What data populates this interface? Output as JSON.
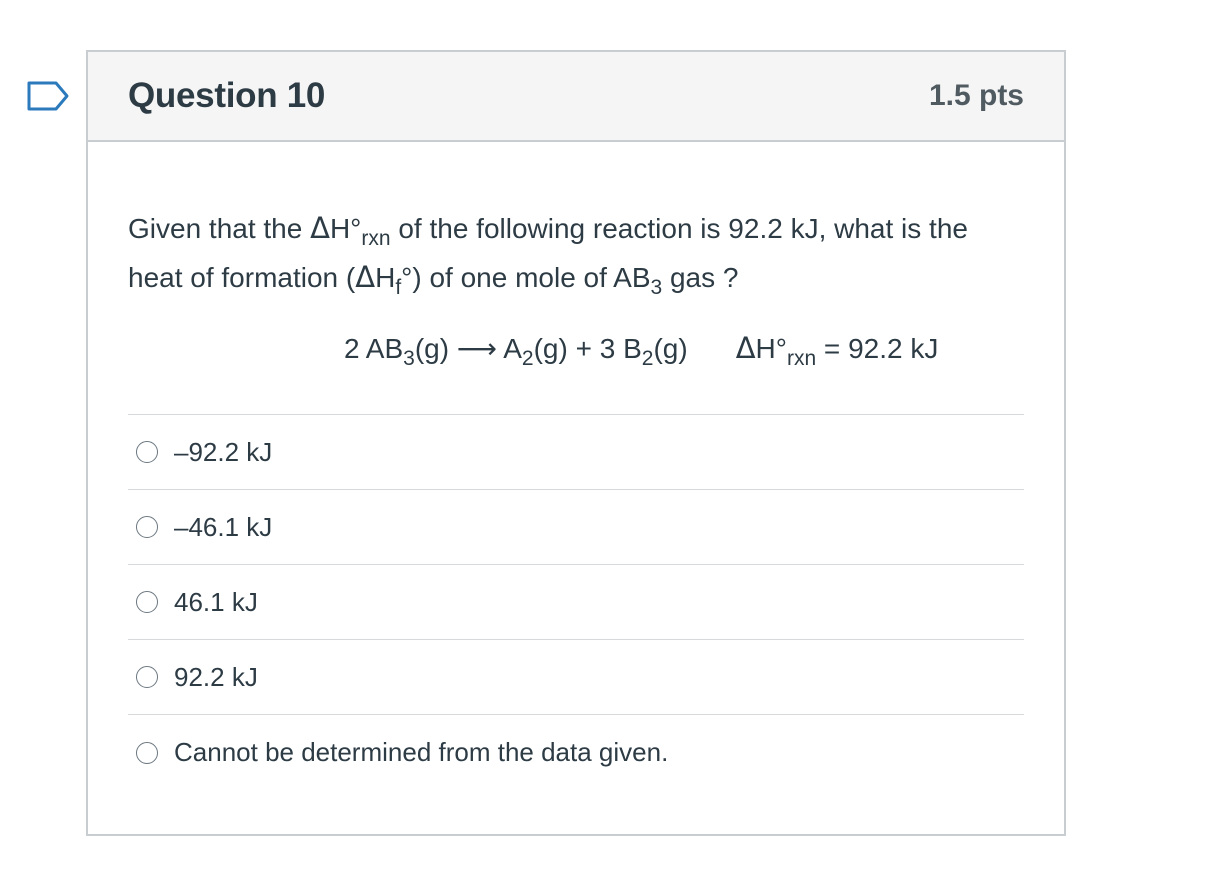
{
  "question": {
    "title": "Question 10",
    "points": "1.5 pts",
    "text_parts": {
      "p1": "Given that the ",
      "delta": "Δ",
      "h_deg": "H°",
      "rxn_sub": "rxn",
      "p2": " of the following reaction is 92.2 kJ, what is the heat of formation (",
      "delta2": "Δ",
      "h": "H",
      "f_sub": "f",
      "deg_close": "°",
      "p3": ") of one mole of AB",
      "three_sub": "3",
      "p4": " gas ?"
    }
  },
  "equation": {
    "lhs_coef": "2 AB",
    "lhs_sub": "3",
    "lhs_state": "(g) ",
    "arrow": "⟶",
    "a2": " A",
    "a2_sub": "2",
    "a2_state": "(g) + 3 B",
    "b2_sub": "2",
    "b2_state": "(g)",
    "delta": "Δ",
    "h_deg": "H°",
    "rxn_sub": "rxn",
    "value": " = 92.2 kJ"
  },
  "answers": [
    {
      "label": "–92.2 kJ"
    },
    {
      "label": "–46.1 kJ"
    },
    {
      "label": "46.1 kJ"
    },
    {
      "label": "92.2 kJ"
    },
    {
      "label": "Cannot be determined from the data given."
    }
  ],
  "colors": {
    "header_bg": "#f5f5f5",
    "border": "#c7cdd1",
    "text": "#2d3b45",
    "flag": "#2b7abc"
  },
  "icons": {
    "flag": "bookmark-flag-icon",
    "radio": "radio-unchecked-icon"
  }
}
